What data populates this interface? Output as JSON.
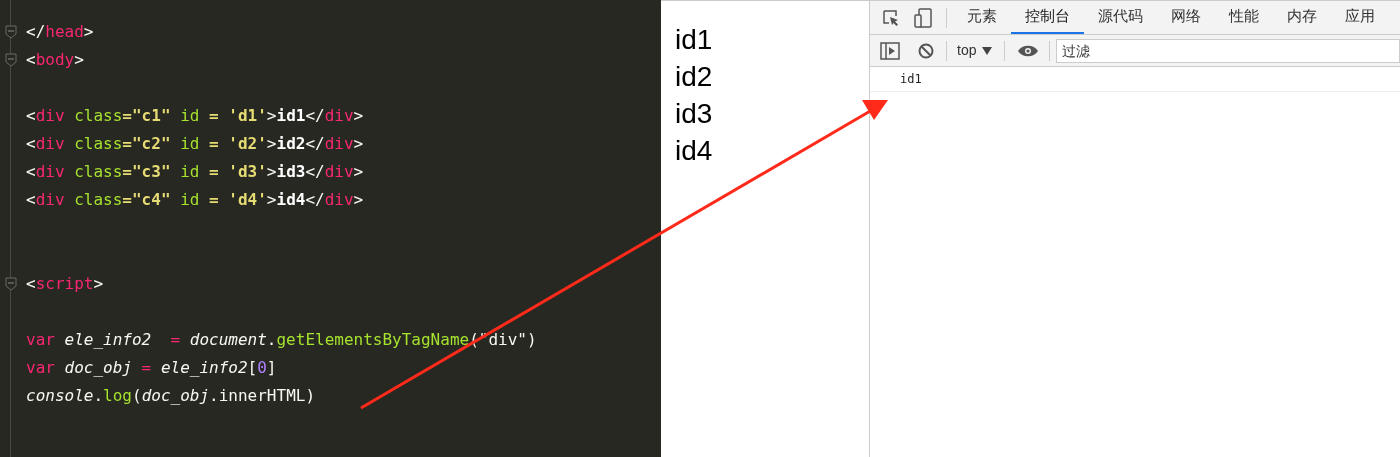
{
  "editor": {
    "lines": [
      {
        "kind": "code",
        "fold": true,
        "tokens": [
          {
            "t": "</",
            "kind": "punct"
          },
          {
            "t": "head",
            "kind": "tag"
          },
          {
            "t": ">",
            "kind": "punct"
          }
        ]
      },
      {
        "kind": "code",
        "fold": true,
        "tokens": [
          {
            "t": "<",
            "kind": "punct"
          },
          {
            "t": "body",
            "kind": "tag"
          },
          {
            "t": ">",
            "kind": "punct"
          }
        ]
      },
      {
        "kind": "blank"
      },
      {
        "kind": "code",
        "fold": false,
        "tokens": [
          {
            "t": "<",
            "kind": "punct"
          },
          {
            "t": "div",
            "kind": "tag"
          },
          {
            "t": " class",
            "kind": "attr"
          },
          {
            "t": "=",
            "kind": "string"
          },
          {
            "t": "\"c1\"",
            "kind": "string"
          },
          {
            "t": " id ",
            "kind": "attr"
          },
          {
            "t": "=",
            "kind": "string"
          },
          {
            "t": " 'd1'",
            "kind": "string"
          },
          {
            "t": ">",
            "kind": "punct"
          },
          {
            "t": "id1",
            "kind": "text"
          },
          {
            "t": "</",
            "kind": "punct"
          },
          {
            "t": "div",
            "kind": "tag"
          },
          {
            "t": ">",
            "kind": "punct"
          }
        ]
      },
      {
        "kind": "code",
        "fold": false,
        "tokens": [
          {
            "t": "<",
            "kind": "punct"
          },
          {
            "t": "div",
            "kind": "tag"
          },
          {
            "t": " class",
            "kind": "attr"
          },
          {
            "t": "=",
            "kind": "string"
          },
          {
            "t": "\"c2\"",
            "kind": "string"
          },
          {
            "t": " id ",
            "kind": "attr"
          },
          {
            "t": "=",
            "kind": "string"
          },
          {
            "t": " 'd2'",
            "kind": "string"
          },
          {
            "t": ">",
            "kind": "punct"
          },
          {
            "t": "id2",
            "kind": "text"
          },
          {
            "t": "</",
            "kind": "punct"
          },
          {
            "t": "div",
            "kind": "tag"
          },
          {
            "t": ">",
            "kind": "punct"
          }
        ]
      },
      {
        "kind": "code",
        "fold": false,
        "tokens": [
          {
            "t": "<",
            "kind": "punct"
          },
          {
            "t": "div",
            "kind": "tag"
          },
          {
            "t": " class",
            "kind": "attr"
          },
          {
            "t": "=",
            "kind": "string"
          },
          {
            "t": "\"c3\"",
            "kind": "string"
          },
          {
            "t": " id ",
            "kind": "attr"
          },
          {
            "t": "=",
            "kind": "string"
          },
          {
            "t": " 'd3'",
            "kind": "string"
          },
          {
            "t": ">",
            "kind": "punct"
          },
          {
            "t": "id3",
            "kind": "text"
          },
          {
            "t": "</",
            "kind": "punct"
          },
          {
            "t": "div",
            "kind": "tag"
          },
          {
            "t": ">",
            "kind": "punct"
          }
        ]
      },
      {
        "kind": "code",
        "fold": false,
        "tokens": [
          {
            "t": "<",
            "kind": "punct"
          },
          {
            "t": "div",
            "kind": "tag"
          },
          {
            "t": " class",
            "kind": "attr"
          },
          {
            "t": "=",
            "kind": "string"
          },
          {
            "t": "\"c4\"",
            "kind": "string"
          },
          {
            "t": " id ",
            "kind": "attr"
          },
          {
            "t": "=",
            "kind": "string"
          },
          {
            "t": " 'd4'",
            "kind": "string"
          },
          {
            "t": ">",
            "kind": "punct"
          },
          {
            "t": "id4",
            "kind": "text"
          },
          {
            "t": "</",
            "kind": "punct"
          },
          {
            "t": "div",
            "kind": "tag"
          },
          {
            "t": ">",
            "kind": "punct"
          }
        ]
      },
      {
        "kind": "blank"
      },
      {
        "kind": "blank"
      },
      {
        "kind": "code",
        "fold": true,
        "tokens": [
          {
            "t": "<",
            "kind": "punct"
          },
          {
            "t": "script",
            "kind": "tag"
          },
          {
            "t": ">",
            "kind": "punct"
          }
        ]
      },
      {
        "kind": "blank"
      },
      {
        "kind": "code",
        "fold": false,
        "tokens": [
          {
            "t": "var",
            "kind": "tag"
          },
          {
            "t": " ele_info2 ",
            "kind": "italic"
          },
          {
            "t": " = ",
            "kind": "tag"
          },
          {
            "t": "document",
            "kind": "italic"
          },
          {
            "t": ".",
            "kind": "punct"
          },
          {
            "t": "getElementsByTagName",
            "kind": "func"
          },
          {
            "t": "(\"div\")",
            "kind": "punct"
          }
        ]
      },
      {
        "kind": "code",
        "fold": false,
        "tokens": [
          {
            "t": "var",
            "kind": "tag"
          },
          {
            "t": " doc_obj ",
            "kind": "italic"
          },
          {
            "t": "= ",
            "kind": "tag"
          },
          {
            "t": "ele_info2",
            "kind": "italic"
          },
          {
            "t": "[",
            "kind": "punct"
          },
          {
            "t": "0",
            "kind": "number"
          },
          {
            "t": "]",
            "kind": "punct"
          }
        ]
      },
      {
        "kind": "code",
        "fold": false,
        "tokens": [
          {
            "t": "console",
            "kind": "italic"
          },
          {
            "t": ".",
            "kind": "punct"
          },
          {
            "t": "log",
            "kind": "func"
          },
          {
            "t": "(",
            "kind": "punct"
          },
          {
            "t": "doc_obj",
            "kind": "italic"
          },
          {
            "t": ".innerHTML)",
            "kind": "punct"
          }
        ]
      }
    ]
  },
  "page": {
    "texts": [
      "id1",
      "id2",
      "id3",
      "id4"
    ]
  },
  "devtools": {
    "tabs": [
      {
        "label": "元素",
        "selected": false
      },
      {
        "label": "控制台",
        "selected": true
      },
      {
        "label": "源代码",
        "selected": false
      },
      {
        "label": "网络",
        "selected": false
      },
      {
        "label": "性能",
        "selected": false
      },
      {
        "label": "内存",
        "selected": false
      },
      {
        "label": "应用",
        "selected": false
      }
    ],
    "context": "top",
    "filter": {
      "placeholder": "过滤"
    },
    "messages": [
      "id1"
    ]
  }
}
